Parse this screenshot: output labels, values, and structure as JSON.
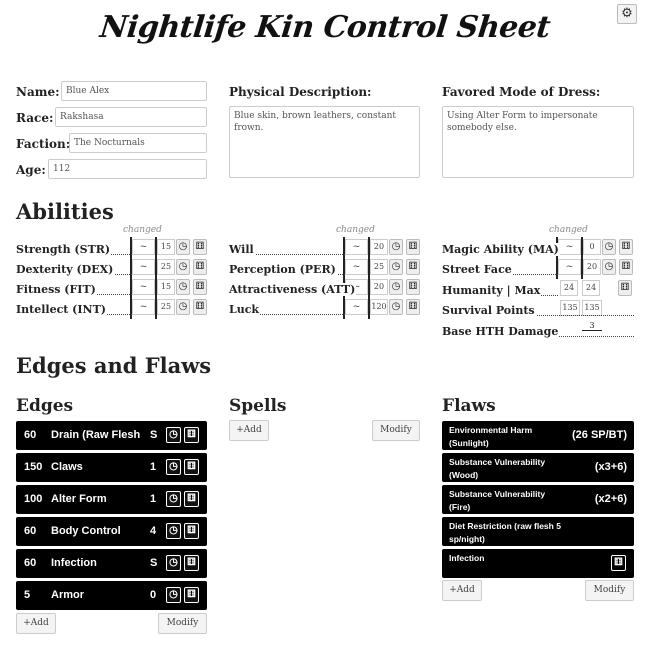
{
  "title": "Nightlife Kin Control Sheet",
  "settings_icon": "gear-icon",
  "basic": {
    "name_label": "Name:",
    "name": "Blue Alex",
    "race_label": "Race:",
    "race": "Rakshasa",
    "faction_label": "Faction:",
    "faction": "The Nocturnals",
    "age_label": "Age:",
    "age": "112"
  },
  "physical": {
    "label": "Physical Description:",
    "value": "Blue skin, brown leathers, constant frown."
  },
  "dress": {
    "label": "Favored Mode of Dress:",
    "value": "Using Alter Form to impersonate somebody else."
  },
  "abilities": {
    "heading": "Abilities",
    "changed_label": "changed",
    "col1": [
      {
        "name": "Strength (STR)",
        "mod": "~",
        "value": "15"
      },
      {
        "name": "Dexterity (DEX)",
        "mod": "~",
        "value": "25"
      },
      {
        "name": "Fitness (FIT)",
        "mod": "~",
        "value": "15"
      },
      {
        "name": "Intellect (INT)",
        "mod": "~",
        "value": "25"
      }
    ],
    "col2": [
      {
        "name": "Will",
        "mod": "~",
        "value": "20"
      },
      {
        "name": "Perception (PER)",
        "mod": "~",
        "value": "25"
      },
      {
        "name": "Attractiveness (ATT)",
        "mod": "~",
        "value": "20"
      },
      {
        "name": "Luck",
        "mod": "~",
        "value": "120"
      }
    ],
    "col3": [
      {
        "name": "Magic Ability (MA)",
        "mod": "~",
        "value": "0"
      },
      {
        "name": "Street Face",
        "mod": "~",
        "value": "20"
      }
    ],
    "humanity": {
      "name": "Humanity | Max",
      "value": "24",
      "max": "24"
    },
    "survival": {
      "name": "Survival Points",
      "value": "135",
      "max": "135"
    },
    "hth": {
      "name": "Base HTH Damage",
      "value": "3"
    }
  },
  "edges_flaws_heading": "Edges and Flaws",
  "edges": {
    "heading": "Edges",
    "items": [
      {
        "cost": "60",
        "name": "Drain (Raw Flesh",
        "level": "S"
      },
      {
        "cost": "150",
        "name": "Claws",
        "level": "1"
      },
      {
        "cost": "100",
        "name": "Alter Form",
        "level": "1"
      },
      {
        "cost": "60",
        "name": "Body Control",
        "level": "4"
      },
      {
        "cost": "60",
        "name": "Infection",
        "level": "S"
      },
      {
        "cost": "5",
        "name": "Armor",
        "level": "0"
      }
    ],
    "add_label": "+Add",
    "modify_label": "Modify"
  },
  "spells": {
    "heading": "Spells",
    "add_label": "+Add",
    "modify_label": "Modify"
  },
  "flaws": {
    "heading": "Flaws",
    "items": [
      {
        "name": "Environmental Harm (Sunlight)",
        "cost": "(26 SP/BT)"
      },
      {
        "name": "Substance Vulnerability (Wood)",
        "cost": "(x3+6)"
      },
      {
        "name": "Substance Vulnerability (Fire)",
        "cost": "(x2+6)"
      },
      {
        "name": "Diet Restriction (raw flesh 5 sp/night)",
        "cost": ""
      },
      {
        "name": "Infection",
        "cost": ""
      }
    ],
    "add_label": "+Add",
    "modify_label": "Modify"
  },
  "icons": {
    "clock": "clock-icon",
    "dice": "dice-icon"
  }
}
